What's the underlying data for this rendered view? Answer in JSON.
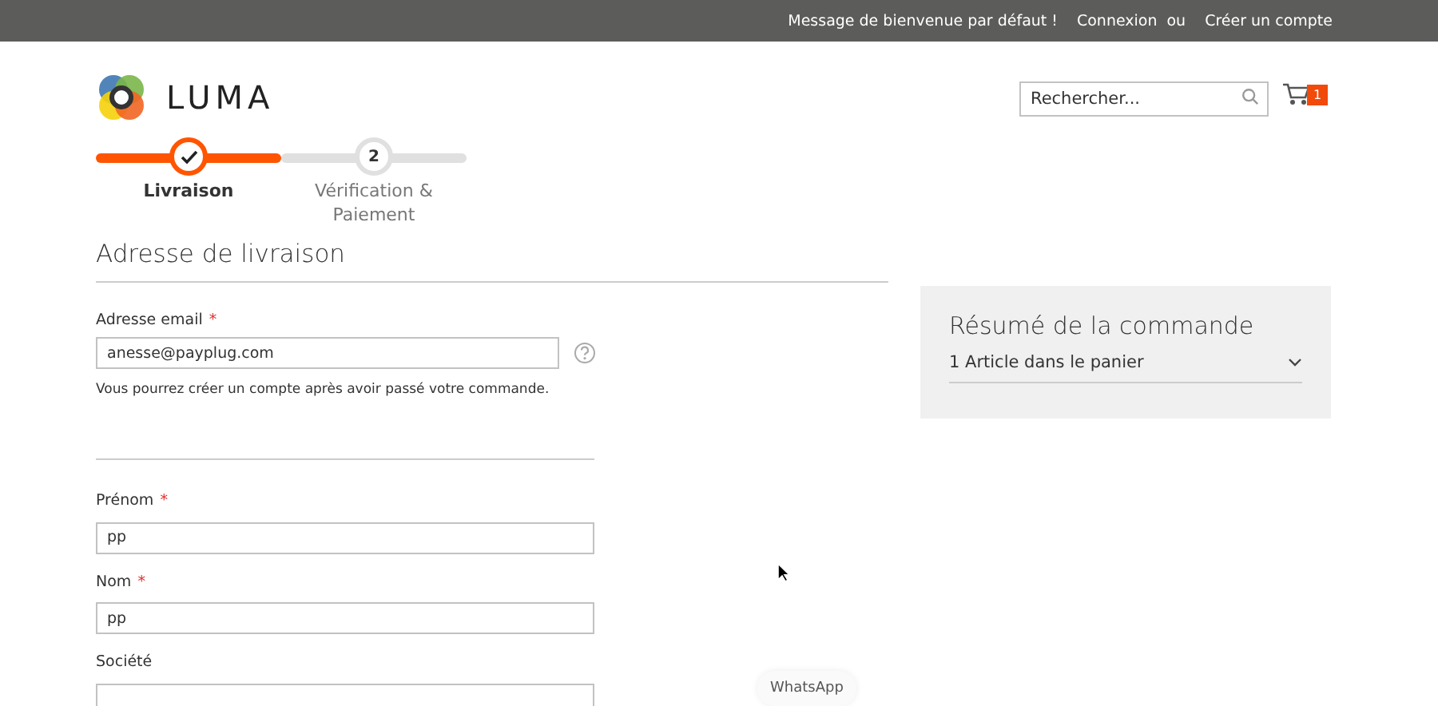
{
  "top_bar": {
    "welcome": "Message de bienvenue par défaut !",
    "links": [
      {
        "label": "Connexion"
      },
      {
        "label": "Créer un compte"
      }
    ],
    "separator": "ou"
  },
  "header": {
    "logo_text": "LUMA",
    "search": {
      "placeholder": "Rechercher..."
    },
    "cart_count": "1"
  },
  "steps": [
    {
      "label": "Livraison",
      "selected": true
    },
    {
      "label": "Vérification & Paiement",
      "number": "2",
      "selected": false
    }
  ],
  "shipping": {
    "title": "Adresse de livraison",
    "email": {
      "label": "Adresse email",
      "required_mark": "*",
      "value": "anesse@payplug.com",
      "note": "Vous pourrez créer un compte après avoir passé votre commande."
    },
    "fields": [
      {
        "label": "Prénom",
        "required_mark": "*",
        "value": "pp"
      },
      {
        "label": "Nom",
        "required_mark": "*",
        "value": "pp"
      },
      {
        "label": "Société"
      }
    ]
  },
  "summary": {
    "title": "Résumé de la commande",
    "items_toggle": "1 Article dans le panier",
    "expanded": false
  },
  "chat_button": "WhatsApp"
}
